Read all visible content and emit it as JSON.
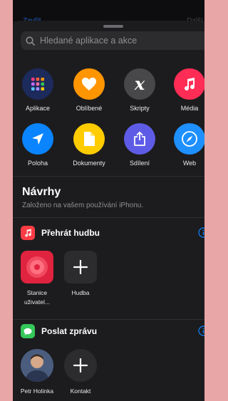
{
  "topbar": {
    "left_label": "Zavřít",
    "right_label": "Další"
  },
  "search": {
    "placeholder": "Hledané aplikace a akce"
  },
  "categories": [
    {
      "label": "Aplikace",
      "icon": "apps-grid-icon",
      "color": "#1d2a5c"
    },
    {
      "label": "Oblíbené",
      "icon": "heart-icon",
      "color": "#ff9500"
    },
    {
      "label": "Skripty",
      "icon": "script-x-icon",
      "color": "#48484a"
    },
    {
      "label": "Média",
      "icon": "music-note-icon",
      "color": "#ff2d55"
    },
    {
      "label": "Poloha",
      "icon": "location-arrow-icon",
      "color": "#0a84ff"
    },
    {
      "label": "Dokumenty",
      "icon": "document-icon",
      "color": "#ffcc00"
    },
    {
      "label": "Sdílení",
      "icon": "share-icon",
      "color": "#5e5ce6"
    },
    {
      "label": "Web",
      "icon": "compass-icon",
      "color": "#1e90ff"
    }
  ],
  "suggestions": {
    "title": "Návrhy",
    "subtitle": "Založeno na vašem používání iPhonu."
  },
  "sections": [
    {
      "title": "Přehrát hudbu",
      "app_icon": "music-app-icon",
      "tiles": [
        {
          "label": "Stanice uživatel...",
          "icon": "radio-station-icon"
        },
        {
          "label": "Hudba",
          "icon": "plus-icon"
        }
      ]
    },
    {
      "title": "Poslat zprávu",
      "app_icon": "messages-app-icon",
      "tiles": [
        {
          "label": "Petr Holinka",
          "icon": "contact-avatar-icon"
        },
        {
          "label": "Kontakt",
          "icon": "plus-icon"
        }
      ]
    }
  ]
}
